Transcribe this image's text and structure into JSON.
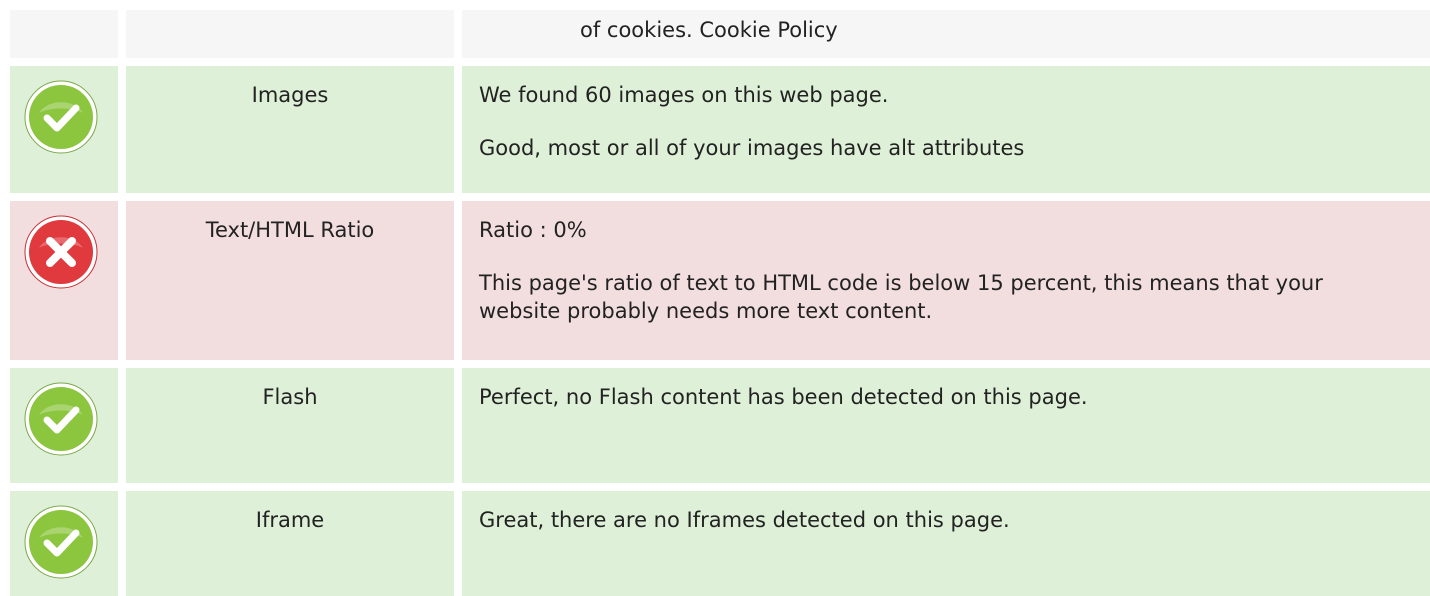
{
  "cookie_row": {
    "text": "of cookies. Cookie Policy"
  },
  "rows": [
    {
      "status": "pass",
      "icon": "check-circle-icon",
      "name": "Images",
      "lines": [
        "We found 60 images on this web page.",
        "Good, most or all of your images have alt attributes"
      ]
    },
    {
      "status": "fail",
      "icon": "x-circle-icon",
      "name": "Text/HTML Ratio",
      "lines": [
        "Ratio : 0%",
        "This page's ratio of text to HTML code is below 15 percent, this means that your website probably needs more text content."
      ]
    },
    {
      "status": "pass",
      "icon": "check-circle-icon",
      "name": "Flash",
      "lines": [
        "Perfect, no Flash content has been detected on this page."
      ]
    },
    {
      "status": "pass",
      "icon": "check-circle-icon",
      "name": "Iframe",
      "lines": [
        "Great, there are no Iframes detected on this page."
      ]
    }
  ],
  "colors": {
    "pass_bg": "#dff0d8",
    "fail_bg": "#f2dede",
    "neutral_bg": "#f6f6f6",
    "pass_icon": "#8cc63f",
    "fail_icon": "#e0393e"
  }
}
